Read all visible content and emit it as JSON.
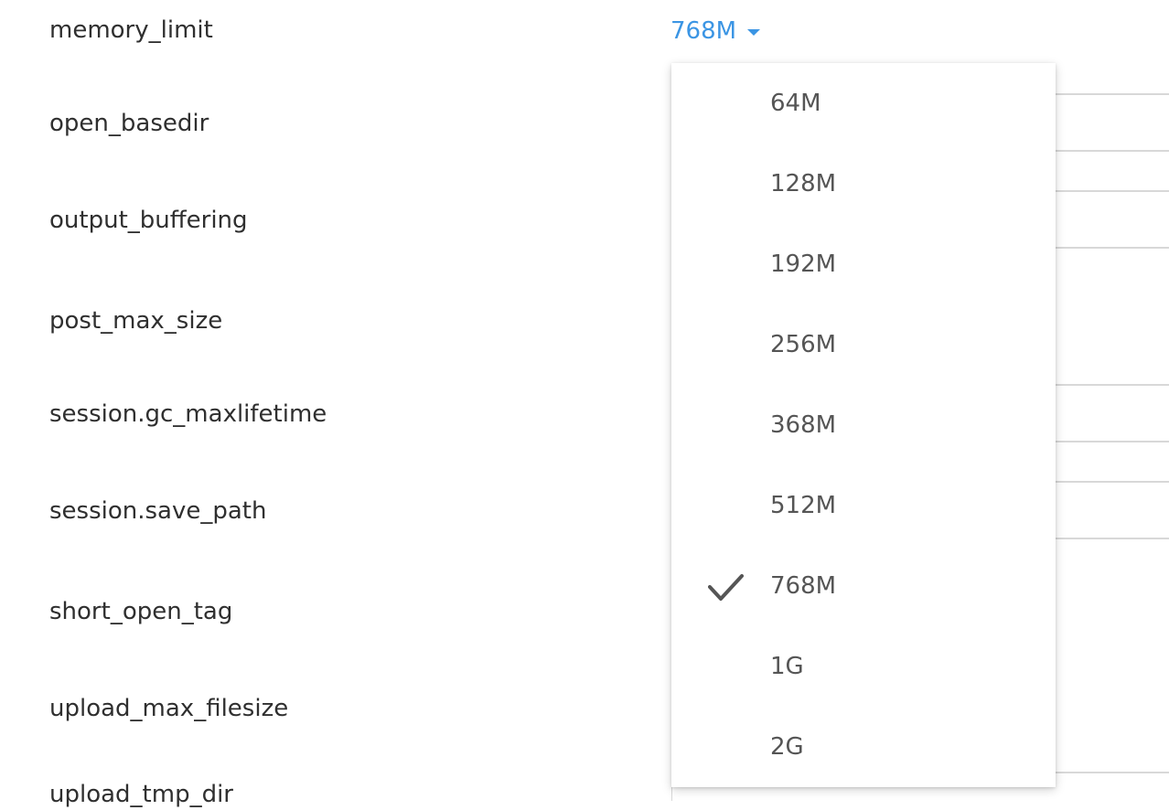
{
  "settings": [
    {
      "name": "memory_limit"
    },
    {
      "name": "open_basedir"
    },
    {
      "name": "output_buffering"
    },
    {
      "name": "post_max_size"
    },
    {
      "name": "session.gc_maxlifetime"
    },
    {
      "name": "session.save_path"
    },
    {
      "name": "short_open_tag"
    },
    {
      "name": "upload_max_filesize"
    },
    {
      "name": "upload_tmp_dir"
    }
  ],
  "memory_limit": {
    "selected_value": "768M",
    "accent_color": "#3b95e4",
    "options": [
      "64M",
      "128M",
      "192M",
      "256M",
      "368M",
      "512M",
      "768M",
      "1G",
      "2G"
    ],
    "checked_icon": "check-icon"
  }
}
